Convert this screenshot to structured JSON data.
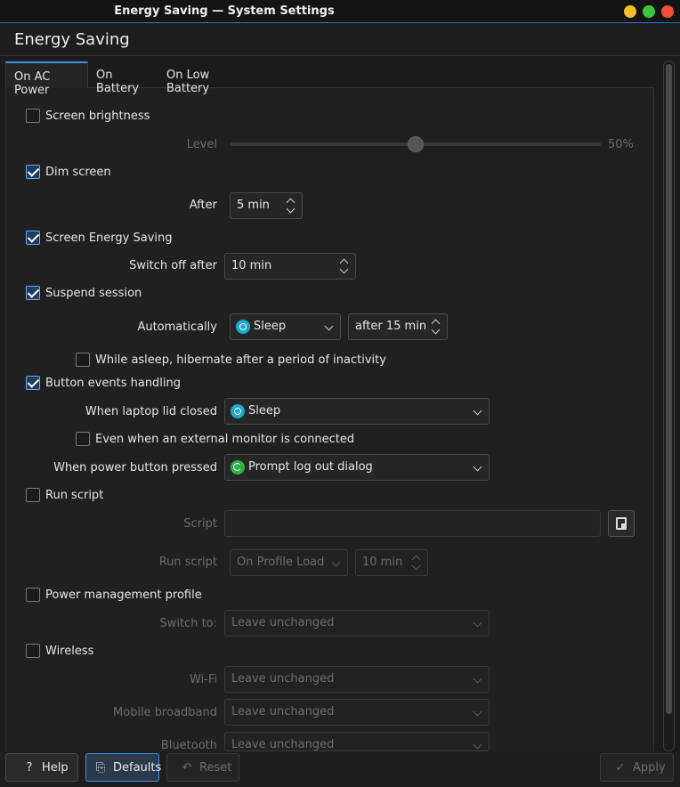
{
  "window": {
    "title": "Energy Saving — System Settings"
  },
  "header": {
    "title": "Energy Saving"
  },
  "tabs": [
    {
      "label": "On AC Power",
      "active": true
    },
    {
      "label": "On Battery",
      "active": false
    },
    {
      "label": "On Low Battery",
      "active": false
    }
  ],
  "screen_brightness": {
    "label": "Screen brightness",
    "checked": false,
    "level_label": "Level",
    "level_value": "50%",
    "level_fraction": 0.5
  },
  "dim_screen": {
    "label": "Dim screen",
    "checked": true,
    "after_label": "After",
    "after_value": "5 min"
  },
  "screen_energy": {
    "label": "Screen Energy Saving",
    "checked": true,
    "switch_label": "Switch off after",
    "switch_value": "10 min"
  },
  "suspend": {
    "label": "Suspend session",
    "checked": true,
    "auto_label": "Automatically",
    "auto_value": "Sleep",
    "after_value": "after 15 min",
    "hibernate_label": "While asleep, hibernate after a period of inactivity",
    "hibernate_checked": false
  },
  "buttons_events": {
    "label": "Button events handling",
    "checked": true,
    "lid_label": "When laptop lid closed",
    "lid_value": "Sleep",
    "monitor_label": "Even when an external monitor is connected",
    "monitor_checked": false,
    "power_label": "When power button pressed",
    "power_value": "Prompt log out dialog"
  },
  "run_script": {
    "label": "Run script",
    "checked": false,
    "script_label": "Script",
    "script_value": "",
    "run_label": "Run script",
    "run_value": "On Profile Load",
    "run_after": "10 min"
  },
  "pm_profile": {
    "label": "Power management profile",
    "checked": false,
    "switch_label": "Switch to:",
    "switch_value": "Leave unchanged"
  },
  "wireless": {
    "label": "Wireless",
    "checked": false,
    "wifi_label": "Wi-Fi",
    "wifi_value": "Leave unchanged",
    "mobile_label": "Mobile broadband",
    "mobile_value": "Leave unchanged",
    "bt_label": "Bluetooth",
    "bt_value": "Leave unchanged"
  },
  "footer": {
    "help": "Help",
    "defaults": "Defaults",
    "reset": "Reset",
    "apply": "Apply"
  },
  "colors": {
    "accent": "#3d8fe3",
    "sleep_icon": "#1fa9c9",
    "logout_icon": "#2fb24a"
  },
  "icons": {
    "help": "question-icon",
    "defaults": "defaults-icon",
    "reset": "undo-icon",
    "apply": "checkmark-icon",
    "script_browse": "open-file-icon"
  }
}
